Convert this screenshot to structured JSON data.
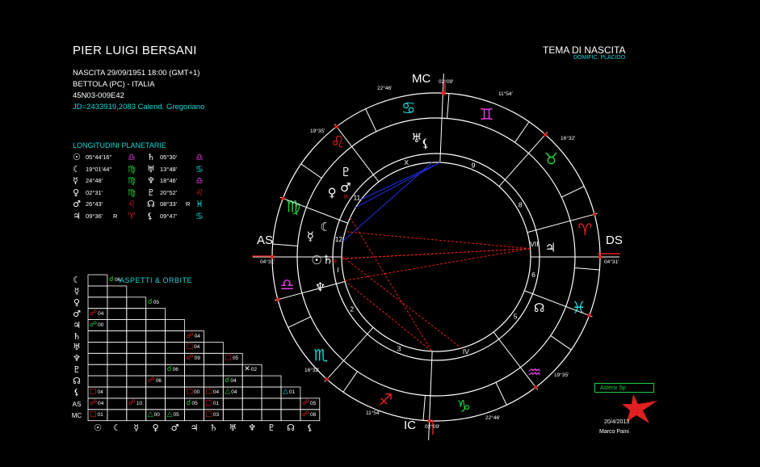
{
  "header": {
    "name": "PIER LUIGI BERSANI",
    "birth": "NASCITA 29/09/1951 18:00 (GMT+1)",
    "place": "BETTOLA (PC) - ITALIA",
    "coords": "45N03-009E42",
    "jd": "JD=2433919,2083  Calend. Gregoriano",
    "chart_title": "TEMA DI NASCITA",
    "house_system": "DOMIFIC. PLACIDO"
  },
  "planet_longitudes": {
    "title": "LONGITUDINI PLANETARIE",
    "rows": [
      [
        {
          "planet": "☉",
          "deg": "05°44'16\"",
          "sign": "♎",
          "color": "m"
        },
        {
          "planet": "♄",
          "deg": "05°30'",
          "sign": "♎",
          "color": "m"
        }
      ],
      [
        {
          "planet": "☾",
          "deg": "19°01'44\"",
          "sign": "♍",
          "color": "g"
        },
        {
          "planet": "♅",
          "deg": "13°48'",
          "sign": "♋",
          "color": "c"
        }
      ],
      [
        {
          "planet": "☿",
          "deg": "24°48'",
          "sign": "♍",
          "color": "g"
        },
        {
          "planet": "♆",
          "deg": "18°46'",
          "sign": "♎",
          "color": "m"
        }
      ],
      [
        {
          "planet": "♀",
          "deg": "02°31'",
          "sign": "♍",
          "color": "g"
        },
        {
          "planet": "♇",
          "deg": "20°52'",
          "sign": "♌",
          "color": "r"
        }
      ],
      [
        {
          "planet": "♂",
          "deg": "26°43'",
          "sign": "♌",
          "color": "r"
        },
        {
          "planet": "☊",
          "deg": "08°33'",
          "sign": "♓",
          "color": "c",
          "retro": "R"
        }
      ],
      [
        {
          "planet": "♃",
          "deg": "09°36'",
          "sign": "♈",
          "color": "r",
          "retro": "R"
        },
        {
          "planet": "⚸",
          "deg": "09°47'",
          "sign": "♋",
          "color": "c"
        }
      ]
    ]
  },
  "aspects": {
    "title": "ASPETTI  &  ORBITE",
    "row_labels": [
      "☾",
      "☿",
      "♀",
      "♂",
      "♃",
      "♄",
      "♅",
      "♆",
      "♇",
      "☊",
      "⚸",
      "AS",
      "MC"
    ],
    "col_labels": [
      "☉",
      "☾",
      "☿",
      "♀",
      "♂",
      "♃",
      "♄",
      "♅",
      "♆",
      "♇",
      "☊",
      "⚸"
    ],
    "entries": [
      {
        "r": 0,
        "c": 1,
        "sym": "☌",
        "orb": "06",
        "col": "g"
      },
      {
        "r": 2,
        "c": 3,
        "sym": "☌",
        "orb": "05",
        "col": "g"
      },
      {
        "r": 3,
        "c": 0,
        "sym": "☍",
        "orb": "04",
        "col": "r"
      },
      {
        "r": 4,
        "c": 0,
        "sym": "☍",
        "orb": "00",
        "col": "g"
      },
      {
        "r": 5,
        "c": 5,
        "sym": "☍",
        "orb": "04",
        "col": "r"
      },
      {
        "r": 6,
        "c": 5,
        "sym": "□",
        "orb": "04",
        "col": "r"
      },
      {
        "r": 7,
        "c": 5,
        "sym": "☍",
        "orb": "09",
        "col": "r"
      },
      {
        "r": 7,
        "c": 7,
        "sym": "□",
        "orb": "05",
        "col": "r"
      },
      {
        "r": 8,
        "c": 4,
        "sym": "☌",
        "orb": "06",
        "col": "g"
      },
      {
        "r": 8,
        "c": 8,
        "sym": "✕",
        "orb": "02",
        "col": "w"
      },
      {
        "r": 9,
        "c": 3,
        "sym": "☍",
        "orb": "06",
        "col": "r"
      },
      {
        "r": 9,
        "c": 7,
        "sym": "☌",
        "orb": "04",
        "col": "g"
      },
      {
        "r": 10,
        "c": 0,
        "sym": "□",
        "orb": "04",
        "col": "r"
      },
      {
        "r": 10,
        "c": 5,
        "sym": "□",
        "orb": "00",
        "col": "r"
      },
      {
        "r": 10,
        "c": 6,
        "sym": "□",
        "orb": "04",
        "col": "r"
      },
      {
        "r": 10,
        "c": 7,
        "sym": "△",
        "orb": "04",
        "col": "g"
      },
      {
        "r": 10,
        "c": 10,
        "sym": "△",
        "orb": "01",
        "col": "c"
      },
      {
        "r": 11,
        "c": 0,
        "sym": "☍",
        "orb": "04",
        "col": "r"
      },
      {
        "r": 11,
        "c": 2,
        "sym": "☍",
        "orb": "10",
        "col": "r"
      },
      {
        "r": 11,
        "c": 5,
        "sym": "☌",
        "orb": "05",
        "col": "g"
      },
      {
        "r": 11,
        "c": 6,
        "sym": "□",
        "orb": "01",
        "col": "r"
      },
      {
        "r": 11,
        "c": 11,
        "sym": "☍",
        "orb": "05",
        "col": "r"
      },
      {
        "r": 12,
        "c": 0,
        "sym": "□",
        "orb": "01",
        "col": "r"
      },
      {
        "r": 12,
        "c": 3,
        "sym": "△",
        "orb": "00",
        "col": "g"
      },
      {
        "r": 12,
        "c": 4,
        "sym": "△",
        "orb": "05",
        "col": "g"
      },
      {
        "r": 12,
        "c": 6,
        "sym": "□",
        "orb": "03",
        "col": "r"
      },
      {
        "r": 12,
        "c": 11,
        "sym": "☍",
        "orb": "08",
        "col": "r"
      }
    ]
  },
  "wheel": {
    "angles": {
      "as": "AS",
      "ds": "DS",
      "mc": "MC",
      "ic": "IC"
    },
    "cusp_degrees": {
      "as": "04°31'",
      "ds": "04°31'",
      "mc": "02°09'",
      "ic": "02°09'",
      "c11": "11°54'",
      "c12": "16°32'",
      "c2": "19°35'",
      "c3": "22°46'",
      "c5": "11°54'",
      "c6": "16°32'",
      "c8": "19°35'",
      "c9": "22°46'"
    },
    "house_numbers": [
      "I",
      "2",
      "3",
      "IV",
      "5",
      "6",
      "VII",
      "8",
      "9",
      "X",
      "11",
      "12"
    ],
    "zodiac": [
      {
        "sign": "♈",
        "color": "r"
      },
      {
        "sign": "♉",
        "color": "g"
      },
      {
        "sign": "♊",
        "color": "m"
      },
      {
        "sign": "♋",
        "color": "c"
      },
      {
        "sign": "♌",
        "color": "r"
      },
      {
        "sign": "♍",
        "color": "g"
      },
      {
        "sign": "♎",
        "color": "m"
      },
      {
        "sign": "♏",
        "color": "c"
      },
      {
        "sign": "♐",
        "color": "r"
      },
      {
        "sign": "♑",
        "color": "g"
      },
      {
        "sign": "♒",
        "color": "m"
      },
      {
        "sign": "♓",
        "color": "c"
      }
    ],
    "retro_mark": "R",
    "colors": {
      "r": "#e02020",
      "g": "#1fcf3a",
      "m": "#e040e0",
      "c": "#19d6d6",
      "w": "#ffffff",
      "blue": "#2030e0"
    }
  },
  "footer": {
    "badge": "Asterix Sp",
    "date": "20/4/2013",
    "author": "Marco Paini"
  }
}
